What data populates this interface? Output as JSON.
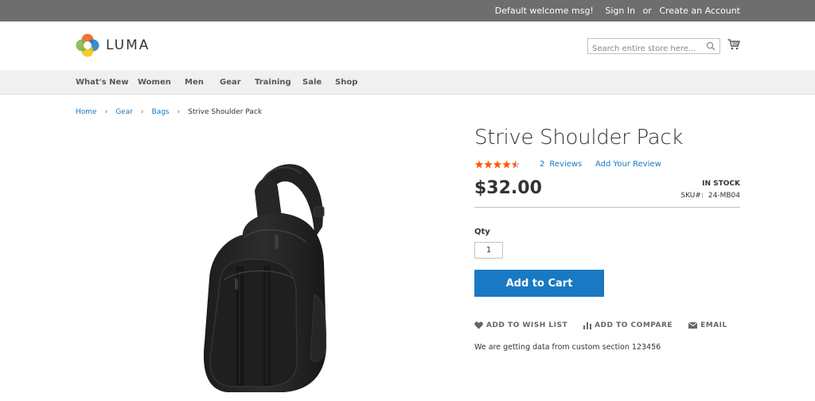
{
  "topbar": {
    "welcome": "Default welcome msg!",
    "sign_in": "Sign In",
    "or": "or",
    "create_account": "Create an Account"
  },
  "header": {
    "logo_text": "LUMA",
    "search_placeholder": "Search entire store here...",
    "cart_icon": "cart-icon"
  },
  "nav": {
    "items": [
      "What's New",
      "Women",
      "Men",
      "Gear",
      "Training",
      "Sale",
      "Shop"
    ]
  },
  "breadcrumb": {
    "items": [
      "Home",
      "Gear",
      "Bags"
    ],
    "current": "Strive Shoulder Pack"
  },
  "product": {
    "title": "Strive Shoulder Pack",
    "rating_stars": 4.5,
    "rating_max": 5,
    "reviews_count": "2",
    "reviews_label": "Reviews",
    "add_review": "Add Your Review",
    "price": "$32.00",
    "stock": "In stock",
    "sku_label": "SKU#:",
    "sku": "24-MB04",
    "qty_label": "Qty",
    "qty_value": "1",
    "add_to_cart": "Add to Cart",
    "wishlist": "ADD TO WISH LIST",
    "compare": "ADD TO COMPARE",
    "email": "EMAIL",
    "custom_text": "We are getting data from custom section 123456"
  },
  "colors": {
    "accent": "#1979c3",
    "star": "#ff5501",
    "topbar": "#6e6e6e"
  }
}
